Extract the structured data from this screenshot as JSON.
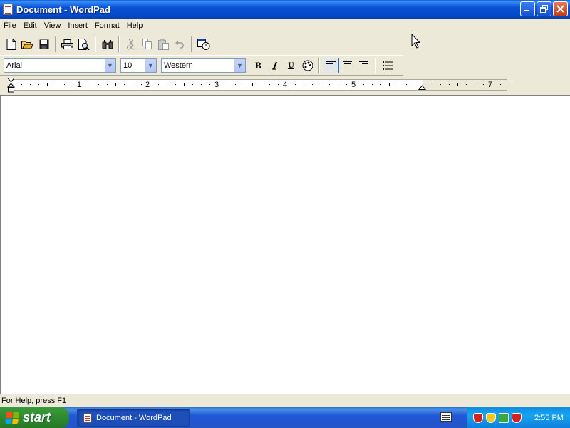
{
  "window": {
    "title": "Document - WordPad",
    "controls": [
      "minimize",
      "restore",
      "close"
    ]
  },
  "menu": {
    "items": [
      "File",
      "Edit",
      "View",
      "Insert",
      "Format",
      "Help"
    ]
  },
  "toolbar": {
    "buttons": [
      "new-icon",
      "open-icon",
      "save-icon",
      "print-icon",
      "print-preview-icon",
      "find-icon",
      "cut-icon",
      "copy-icon",
      "paste-icon",
      "undo-icon",
      "insert-date-time-icon"
    ]
  },
  "format_bar": {
    "font": "Arial",
    "size": "10",
    "script": "Western",
    "bold": "B",
    "italic": "I",
    "underline": "U"
  },
  "ruler": {
    "labels": [
      "1",
      "2",
      "3",
      "4",
      "5",
      "7"
    ]
  },
  "status": {
    "text": "For Help, press F1"
  },
  "taskbar": {
    "start_label": "start",
    "task_label": "Document - WordPad",
    "clock": "2:55 PM"
  },
  "colors": {
    "titlebar": "#0a52d6",
    "taskbar": "#2456c7",
    "start": "#2f8a2f",
    "tray": "#16a3f0"
  }
}
